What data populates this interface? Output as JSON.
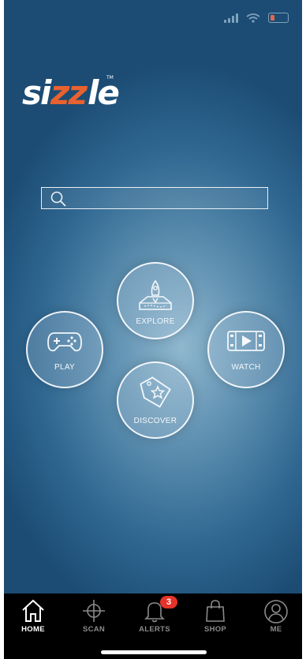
{
  "brand": {
    "logo_text": "sizzle",
    "trademark": "TM"
  },
  "search": {
    "value": "",
    "placeholder": ""
  },
  "menu": [
    {
      "label": "EXPLORE",
      "icon": "rocket-map-icon"
    },
    {
      "label": "PLAY",
      "icon": "gamepad-icon"
    },
    {
      "label": "WATCH",
      "icon": "video-play-icon"
    },
    {
      "label": "DISCOVER",
      "icon": "star-tag-icon"
    }
  ],
  "tabbar": {
    "items": [
      {
        "label": "HOME",
        "icon": "home-icon",
        "active": true
      },
      {
        "label": "SCAN",
        "icon": "crosshair-icon",
        "active": false
      },
      {
        "label": "ALERTS",
        "icon": "bell-icon",
        "active": false,
        "badge": "3"
      },
      {
        "label": "SHOP",
        "icon": "shopping-bag-icon",
        "active": false
      },
      {
        "label": "ME",
        "icon": "user-icon",
        "active": false
      }
    ]
  },
  "colors": {
    "accent": "#e8622f",
    "badge": "#e5332a",
    "tab_background": "#000000"
  }
}
